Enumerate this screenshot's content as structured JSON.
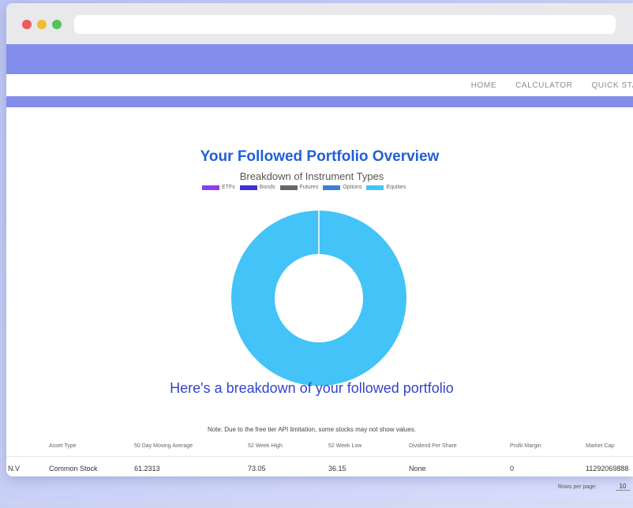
{
  "nav": {
    "links": [
      "HOME",
      "CALCULATOR",
      "QUICK STA"
    ]
  },
  "main": {
    "title": "Your Followed Portfolio Overview",
    "subheading": "Here's a breakdown of your followed portfolio",
    "note": "Note: Due to the free tier API limitation, some stocks may not show values."
  },
  "chart_data": {
    "type": "pie",
    "title": "Breakdown of Instrument Types",
    "series": [
      {
        "name": "ETFs",
        "value": 0,
        "color": "#8a3ff0"
      },
      {
        "name": "Bonds",
        "value": 0,
        "color": "#3a2fd6"
      },
      {
        "name": "Futures",
        "value": 0,
        "color": "#666666"
      },
      {
        "name": "Options",
        "value": 0,
        "color": "#3b7dd8"
      },
      {
        "name": "Equities",
        "value": 1,
        "color": "#43c3f7"
      }
    ],
    "legend": "top",
    "donut": true
  },
  "table": {
    "headers": [
      "Asset Type",
      "50 Day Moving Average",
      "52 Week High",
      "52 Week Low",
      "Dividend Per Share",
      "Profit Margin",
      "Market Cap"
    ],
    "first_col_cell": "N.V",
    "rows": [
      [
        "Common Stock",
        "61.2313",
        "73.05",
        "36.15",
        "None",
        "0",
        "11292069888"
      ]
    ]
  },
  "pagination": {
    "rows_per_page_label": "Rows per page:",
    "rows_per_page_value": "10"
  }
}
